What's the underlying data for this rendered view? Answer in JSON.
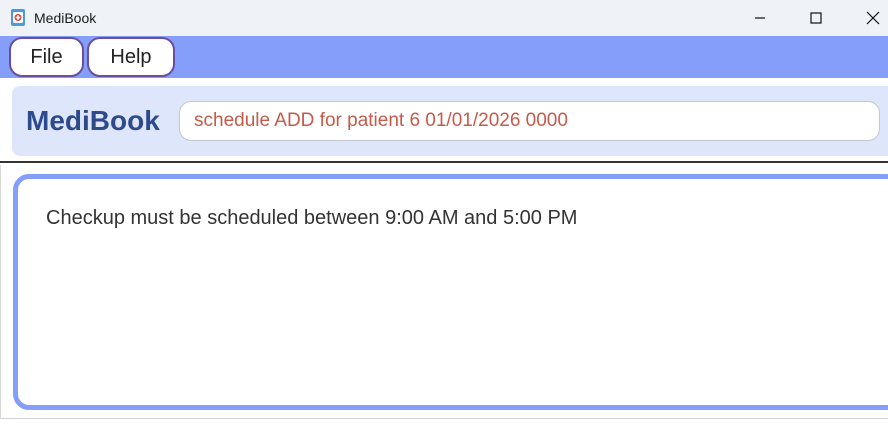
{
  "window": {
    "title": "MediBook",
    "controls": {
      "minimize": "minimize-icon",
      "maximize": "maximize-icon",
      "close": "close-icon"
    }
  },
  "menu": {
    "items": [
      {
        "label": "File"
      },
      {
        "label": "Help"
      }
    ]
  },
  "header": {
    "brand": "MediBook",
    "command_input": {
      "value": "schedule ADD for patient 6 01/01/2026 0000"
    }
  },
  "result": {
    "message": "Checkup must be scheduled between 9:00 AM and 5:00 PM"
  },
  "colors": {
    "menubar": "#859ef9",
    "menu_border": "#6b4ea0",
    "brand": "#2e4a8a",
    "command_text": "#c65a4a",
    "command_panel": "#dde6fb",
    "result_border": "#859ef9"
  }
}
